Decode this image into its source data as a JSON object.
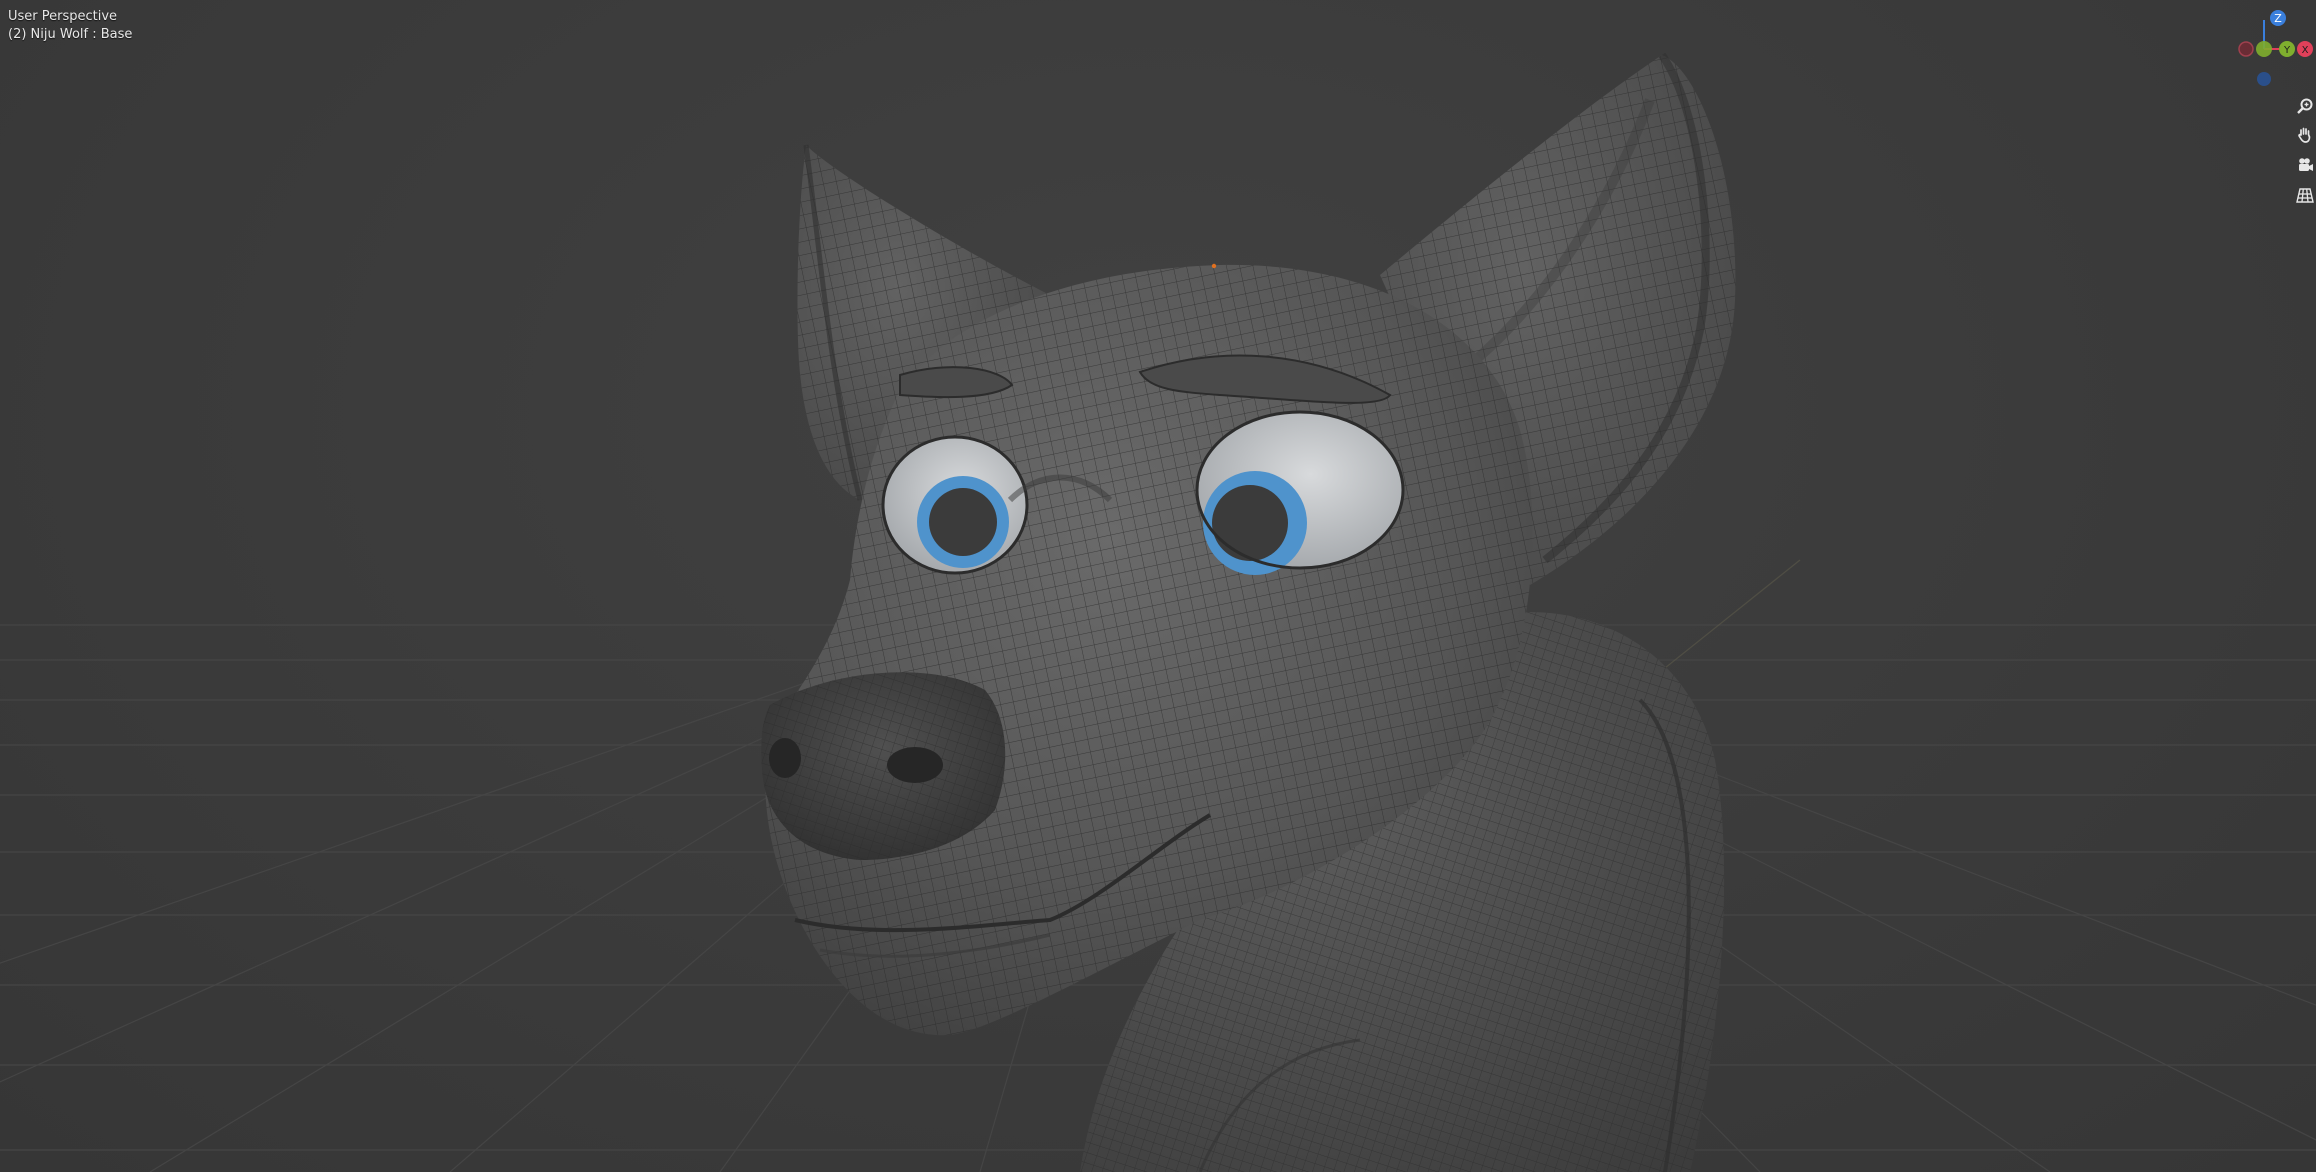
{
  "viewport": {
    "view_name": "User Perspective",
    "object_info": "(2) Niju Wolf : Base"
  },
  "gizmo": {
    "z_label": "Z",
    "y_label": "Y",
    "x_label": "X",
    "colors": {
      "x": "#e0405a",
      "y": "#7fae2e",
      "z": "#3a7fdc"
    }
  },
  "nav_buttons": [
    {
      "name": "zoom",
      "icon": "magnifier-icon"
    },
    {
      "name": "pan",
      "icon": "hand-icon"
    },
    {
      "name": "camera",
      "icon": "camera-icon"
    },
    {
      "name": "ortho-toggle",
      "icon": "grid-icon"
    }
  ],
  "scene": {
    "model": "wolf-head-mesh",
    "eye_iris_color": "#4f93cc",
    "background_color": "#3a3a3a",
    "grid_color": "#4a4a4a"
  }
}
